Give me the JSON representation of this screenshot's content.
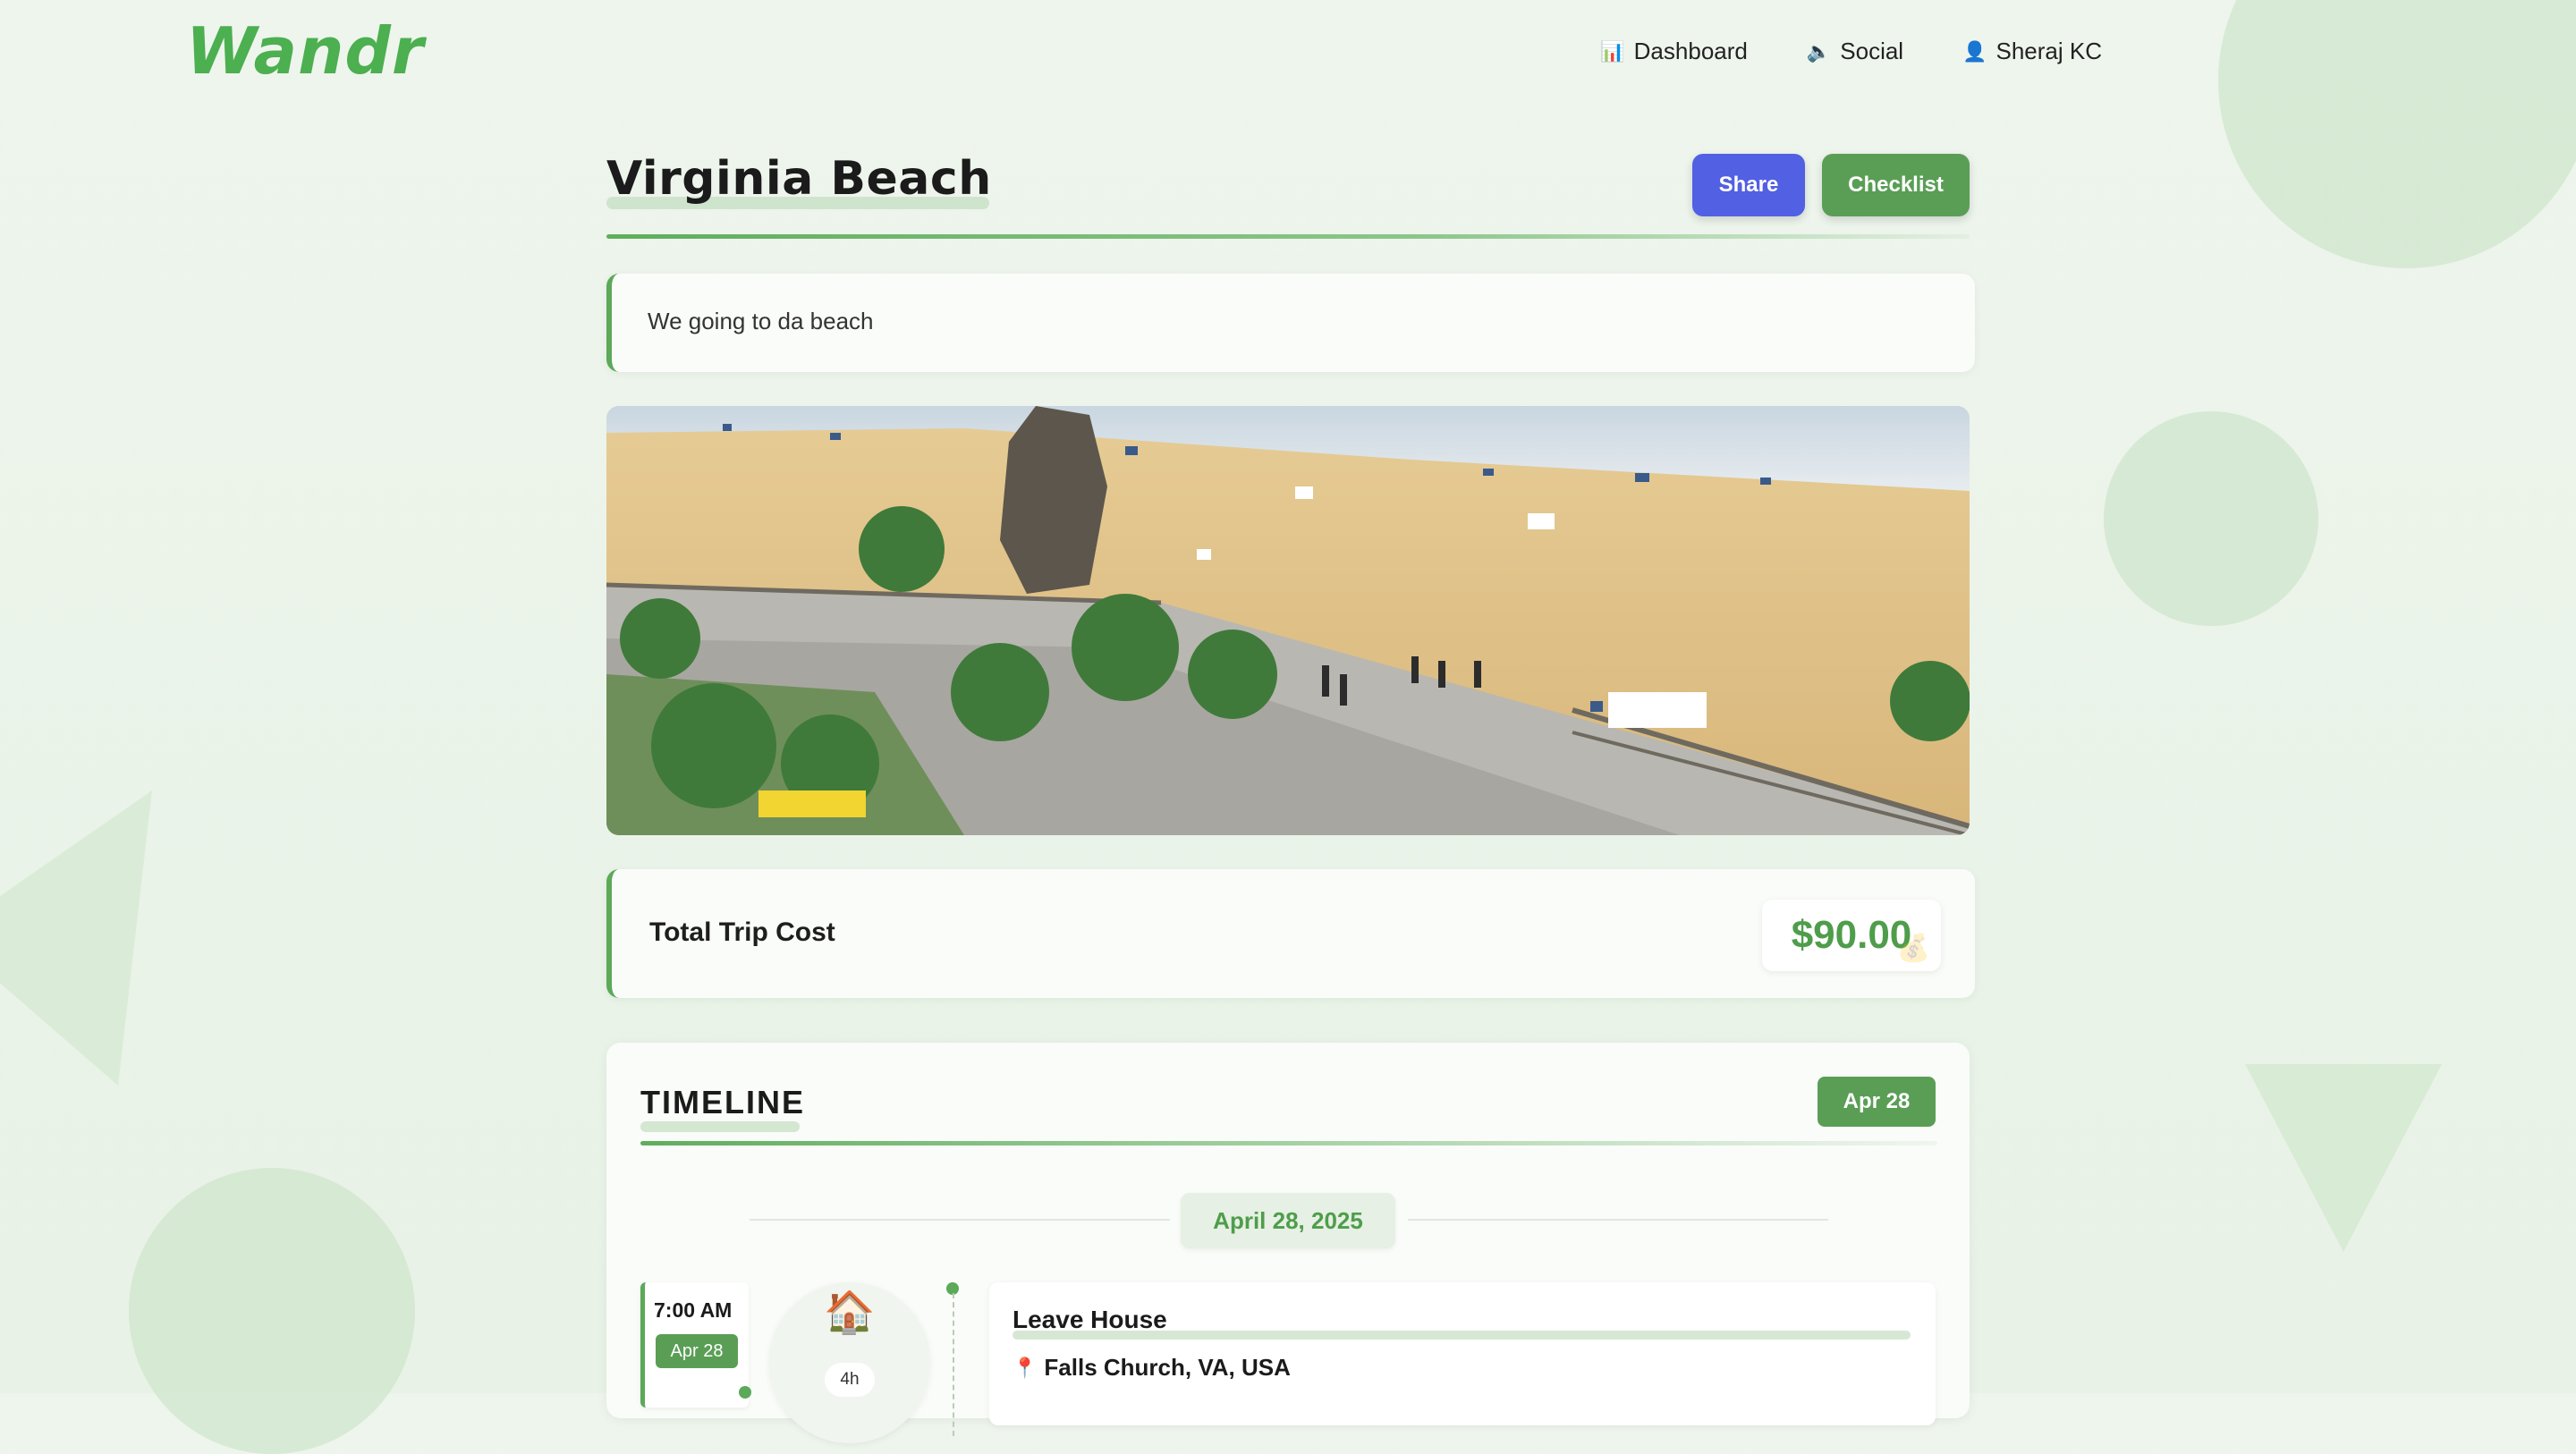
{
  "nav": {
    "logo": "Wandr",
    "links": [
      {
        "label": "Dashboard",
        "icon": "📊"
      },
      {
        "label": "Social",
        "icon": "🔈"
      },
      {
        "label": "Sheraj KC",
        "icon": "👤"
      }
    ]
  },
  "trip": {
    "title": "Virginia Beach",
    "share_label": "Share",
    "checklist_label": "Checklist",
    "description": "We going to da beach",
    "cost_label": "Total Trip Cost",
    "cost_value": "$90.00"
  },
  "timeline": {
    "title": "TIMELINE",
    "badge": "Apr 28",
    "date_header": "April 28, 2025",
    "events": [
      {
        "time": "7:00 AM",
        "date": "Apr 28",
        "icon": "🏠",
        "duration": "4h",
        "title": "Leave House",
        "location": "Falls Church, VA, USA"
      }
    ]
  },
  "colors": {
    "accent_green": "#5a9e56",
    "share_blue": "#5260e3",
    "cost_green": "#4f9d4b"
  }
}
